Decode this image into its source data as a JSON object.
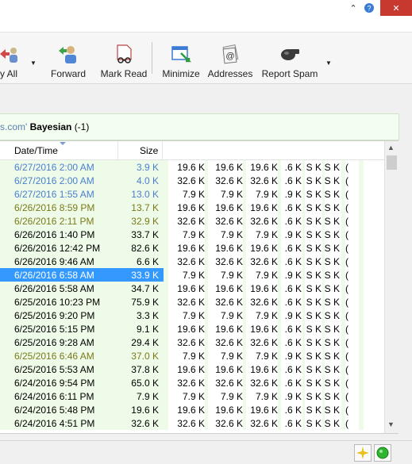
{
  "window": {
    "close_glyph": "✕",
    "chevron_glyph": "⌃"
  },
  "toolbar": {
    "reply_all_label": "y All",
    "forward_label": "Forward",
    "mark_read_label": "Mark Read",
    "minimize_label": "Minimize",
    "addresses_label": "Addresses",
    "report_spam_label": "Report Spam"
  },
  "filter": {
    "prefix": "s.com'",
    "bold": "Bayesian",
    "suffix": "(-1)"
  },
  "list": {
    "headers": {
      "date": "Date/Time",
      "size": "Size"
    },
    "rows": [
      {
        "date": "6/27/2016 2:00 AM",
        "size": "3.9 K",
        "c1": "19.6 K",
        "c2": "19.6 K",
        "c3": "19.6 K",
        "c4": ".6 K",
        "c5": "S K",
        "c6": "S K",
        "c7": "(",
        "color": "blue"
      },
      {
        "date": "6/27/2016 2:00 AM",
        "size": "4.0 K",
        "c1": "32.6 K",
        "c2": "32.6 K",
        "c3": "32.6 K",
        "c4": ".6 K",
        "c5": "S K",
        "c6": "S K",
        "c7": "(",
        "color": "blue"
      },
      {
        "date": "6/27/2016 1:55 AM",
        "size": "13.0 K",
        "c1": "7.9 K",
        "c2": "7.9 K",
        "c3": "7.9 K",
        "c4": ".9 K",
        "c5": "S K",
        "c6": "S K",
        "c7": "(",
        "color": "blue"
      },
      {
        "date": "6/26/2016 8:59 PM",
        "size": "13.7 K",
        "c1": "19.6 K",
        "c2": "19.6 K",
        "c3": "19.6 K",
        "c4": ".6 K",
        "c5": "S K",
        "c6": "S K",
        "c7": "(",
        "color": "olive"
      },
      {
        "date": "6/26/2016 2:11 PM",
        "size": "32.9 K",
        "c1": "32.6 K",
        "c2": "32.6 K",
        "c3": "32.6 K",
        "c4": ".6 K",
        "c5": "S K",
        "c6": "S K",
        "c7": "(",
        "color": "olive"
      },
      {
        "date": "6/26/2016 1:40 PM",
        "size": "33.7 K",
        "c1": "7.9 K",
        "c2": "7.9 K",
        "c3": "7.9 K",
        "c4": ".9 K",
        "c5": "S K",
        "c6": "S K",
        "c7": "(",
        "color": ""
      },
      {
        "date": "6/26/2016 12:42 PM",
        "size": "82.6 K",
        "c1": "19.6 K",
        "c2": "19.6 K",
        "c3": "19.6 K",
        "c4": ".6 K",
        "c5": "S K",
        "c6": "S K",
        "c7": "(",
        "color": ""
      },
      {
        "date": "6/26/2016 9:46 AM",
        "size": "6.6 K",
        "c1": "32.6 K",
        "c2": "32.6 K",
        "c3": "32.6 K",
        "c4": ".6 K",
        "c5": "S K",
        "c6": "S K",
        "c7": "(",
        "color": ""
      },
      {
        "date": "6/26/2016 6:58 AM",
        "size": "33.9 K",
        "c1": "7.9 K",
        "c2": "7.9 K",
        "c3": "7.9 K",
        "c4": ".9 K",
        "c5": "S K",
        "c6": "S K",
        "c7": "(",
        "color": "",
        "selected": true
      },
      {
        "date": "6/26/2016 5:58 AM",
        "size": "34.7 K",
        "c1": "19.6 K",
        "c2": "19.6 K",
        "c3": "19.6 K",
        "c4": ".6 K",
        "c5": "S K",
        "c6": "S K",
        "c7": "(",
        "color": ""
      },
      {
        "date": "6/25/2016 10:23 PM",
        "size": "75.9 K",
        "c1": "32.6 K",
        "c2": "32.6 K",
        "c3": "32.6 K",
        "c4": ".6 K",
        "c5": "S K",
        "c6": "S K",
        "c7": "(",
        "color": ""
      },
      {
        "date": "6/25/2016 9:20 PM",
        "size": "3.3 K",
        "c1": "7.9 K",
        "c2": "7.9 K",
        "c3": "7.9 K",
        "c4": ".9 K",
        "c5": "S K",
        "c6": "S K",
        "c7": "(",
        "color": ""
      },
      {
        "date": "6/25/2016 5:15 PM",
        "size": "9.1 K",
        "c1": "19.6 K",
        "c2": "19.6 K",
        "c3": "19.6 K",
        "c4": ".6 K",
        "c5": "S K",
        "c6": "S K",
        "c7": "(",
        "color": ""
      },
      {
        "date": "6/25/2016 9:28 AM",
        "size": "29.4 K",
        "c1": "32.6 K",
        "c2": "32.6 K",
        "c3": "32.6 K",
        "c4": ".6 K",
        "c5": "S K",
        "c6": "S K",
        "c7": "(",
        "color": ""
      },
      {
        "date": "6/25/2016 6:46 AM",
        "size": "37.0 K",
        "c1": "7.9 K",
        "c2": "7.9 K",
        "c3": "7.9 K",
        "c4": ".9 K",
        "c5": "S K",
        "c6": "S K",
        "c7": "(",
        "color": "olive"
      },
      {
        "date": "6/25/2016 5:53 AM",
        "size": "37.8 K",
        "c1": "19.6 K",
        "c2": "19.6 K",
        "c3": "19.6 K",
        "c4": ".6 K",
        "c5": "S K",
        "c6": "S K",
        "c7": "(",
        "color": ""
      },
      {
        "date": "6/24/2016 9:54 PM",
        "size": "65.0 K",
        "c1": "32.6 K",
        "c2": "32.6 K",
        "c3": "32.6 K",
        "c4": ".6 K",
        "c5": "S K",
        "c6": "S K",
        "c7": "(",
        "color": ""
      },
      {
        "date": "6/24/2016 6:11 PM",
        "size": "7.9 K",
        "c1": "7.9 K",
        "c2": "7.9 K",
        "c3": "7.9 K",
        "c4": ".9 K",
        "c5": "S K",
        "c6": "S K",
        "c7": "(",
        "color": ""
      },
      {
        "date": "6/24/2016 5:48 PM",
        "size": "19.6 K",
        "c1": "19.6 K",
        "c2": "19.6 K",
        "c3": "19.6 K",
        "c4": ".6 K",
        "c5": "S K",
        "c6": "S K",
        "c7": "(",
        "color": ""
      },
      {
        "date": "6/24/2016 4:51 PM",
        "size": "32.6 K",
        "c1": "32.6 K",
        "c2": "32.6 K",
        "c3": "32.6 K",
        "c4": ".6 K",
        "c5": "S K",
        "c6": "S K",
        "c7": "(",
        "color": ""
      }
    ]
  },
  "colors": {
    "selected": "#3399ff",
    "blue_text": "#4a7fd0",
    "olive_text": "#7a7a1a",
    "green_bg": "#eefbe8"
  }
}
